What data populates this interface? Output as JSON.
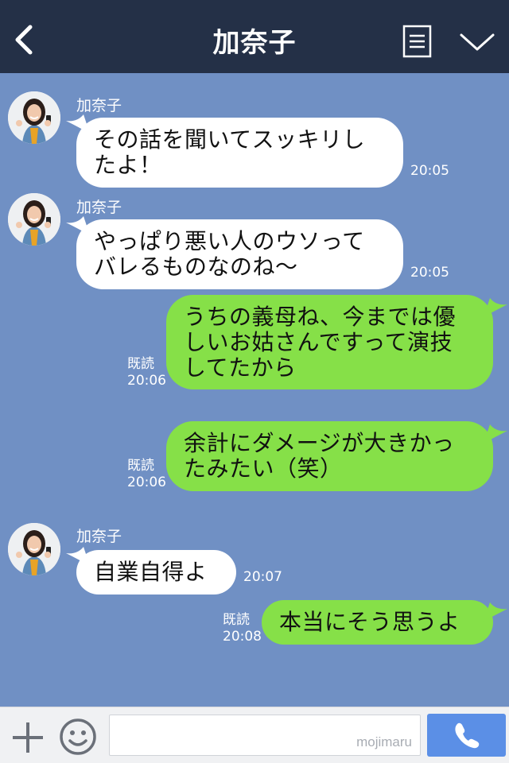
{
  "header": {
    "title": "加奈子"
  },
  "icons": {
    "back": "back-arrow-icon",
    "menu": "menu-icon",
    "chevron": "chevron-down-icon",
    "add": "plus-icon",
    "emoji": "smiley-icon",
    "call": "phone-icon"
  },
  "colors": {
    "header_bg": "#243047",
    "chat_bg": "#7090c4",
    "incoming_bubble": "#ffffff",
    "outgoing_bubble": "#86e048",
    "call_button": "#5b8fe6"
  },
  "messages": [
    {
      "direction": "in",
      "sender": "加奈子",
      "text": "その話を聞いてスッキリし\nたよ！",
      "time": "20:05"
    },
    {
      "direction": "in",
      "sender": "加奈子",
      "text": "やっぱり悪い人のウソって\nバレるものなのね〜",
      "time": "20:05"
    },
    {
      "direction": "out",
      "read": "既読",
      "text": "うちの義母ね、今までは優\nしいお姑さんですって演技\nしてたから",
      "time": "20:06"
    },
    {
      "direction": "out",
      "read": "既読",
      "text": "余計にダメージが大きかっ\nたみたい（笑）",
      "time": "20:06"
    },
    {
      "direction": "in",
      "sender": "加奈子",
      "text": "自業自得よ",
      "time": "20:07"
    },
    {
      "direction": "out",
      "read": "既読",
      "text": "本当にそう思うよ",
      "time": "20:08"
    }
  ],
  "input": {
    "watermark": "mojimaru",
    "value": ""
  }
}
